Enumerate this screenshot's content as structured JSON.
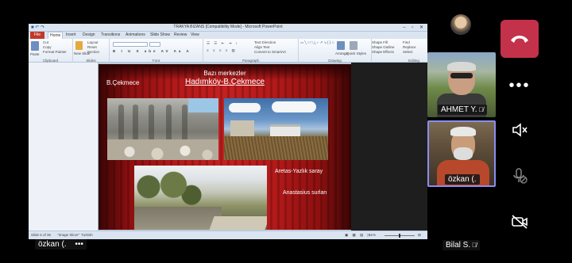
{
  "powerpoint": {
    "window_title": "TRAKYA BIZANS [Compatibility Mode] - Microsoft PowerPoint",
    "file_tab": "File",
    "tabs": [
      "Home",
      "Insert",
      "Design",
      "Transitions",
      "Animations",
      "Slide Show",
      "Review",
      "View"
    ],
    "ribbon_groups": [
      "Clipboard",
      "Slides",
      "Font",
      "Paragraph",
      "Drawing",
      "Editing"
    ],
    "ribbon_items": {
      "paste": "Paste",
      "cut": "Cut",
      "copy": "Copy",
      "format_painter": "Format Painter",
      "new_slide": "New Slide",
      "layout": "Layout",
      "reset": "Reset",
      "section": "Section",
      "text_direction": "Text Direction",
      "align_text": "Align Text",
      "convert_smartart": "Convert to SmartArt",
      "arrange": "Arrange",
      "quick_styles": "Quick Styles",
      "shape_fill": "Shape Fill",
      "shape_outline": "Shape Outline",
      "shape_effects": "Shape Effects",
      "find": "Find",
      "replace": "Replace",
      "select": "Select"
    },
    "slide": {
      "subtitle": "Bazı merkezler",
      "title": "Hadımköy-B.Çekmece",
      "left_label": "B.Çekmece",
      "caption_1": "Aretas-Yazlık saray",
      "caption_2": "Anastasius surları"
    },
    "status": {
      "slide_counter": "Slide 6 of 36",
      "theme": "\"Image Slicer\"",
      "language": "Turkish",
      "zoom": "61%"
    }
  },
  "teams": {
    "participants": [
      {
        "name": "AHMET Y.",
        "muted": true
      },
      {
        "name": "özkan (.",
        "muted": false
      },
      {
        "name": "Bilal S.",
        "muted": true
      }
    ],
    "main_badge": {
      "name": "özkan (.",
      "more": "•••"
    },
    "more_label": "•••"
  },
  "colors": {
    "hangup": "#c4314b",
    "active_border": "#8a8ef0",
    "slide_red": "#b31919"
  }
}
